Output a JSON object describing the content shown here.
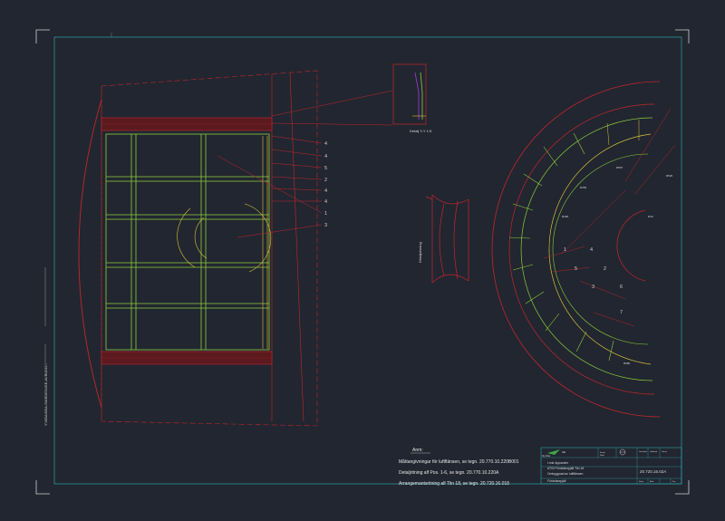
{
  "drawing": {
    "detail_label": "Detalj Y-Y 1:5",
    "section_label": "Detaljvisning",
    "left_margin_text": "Y:\\SEA\\SEA-SWEDEN\\ISE-AVRULL\\...",
    "notes": {
      "heading": "Anm:",
      "lines": [
        "Måttangivningar för luftflänsen, se tegn. 20.770.10.220B001",
        "Detaljritning alf Pos. 1-6, se tegn. 20.770.10.220A",
        "Arrangemantsritning alf Tlin 18, se tegn. 20.720.16.018"
      ]
    },
    "callouts_left": [
      "4",
      "4",
      "5",
      "2",
      "4",
      "4",
      "1",
      "3"
    ],
    "callouts_right": [
      "1",
      "2",
      "3",
      "4",
      "5",
      "6",
      "7"
    ]
  },
  "title_block": {
    "company_line": "Ny Kräv",
    "project_lines": [
      "I.mkr Apparater",
      "AT03 Fördelarspjäll Tlin 18",
      "Ombyggnad av luftflänsen"
    ],
    "drawing_number": "20.720.16.02A",
    "bottom_left": "Fördelarspjäll",
    "small_fields": [
      "Konstr.",
      "Ritad",
      "Granskad",
      "Godkänd",
      "Datum",
      "Skala",
      "Blad",
      "Rev"
    ]
  }
}
